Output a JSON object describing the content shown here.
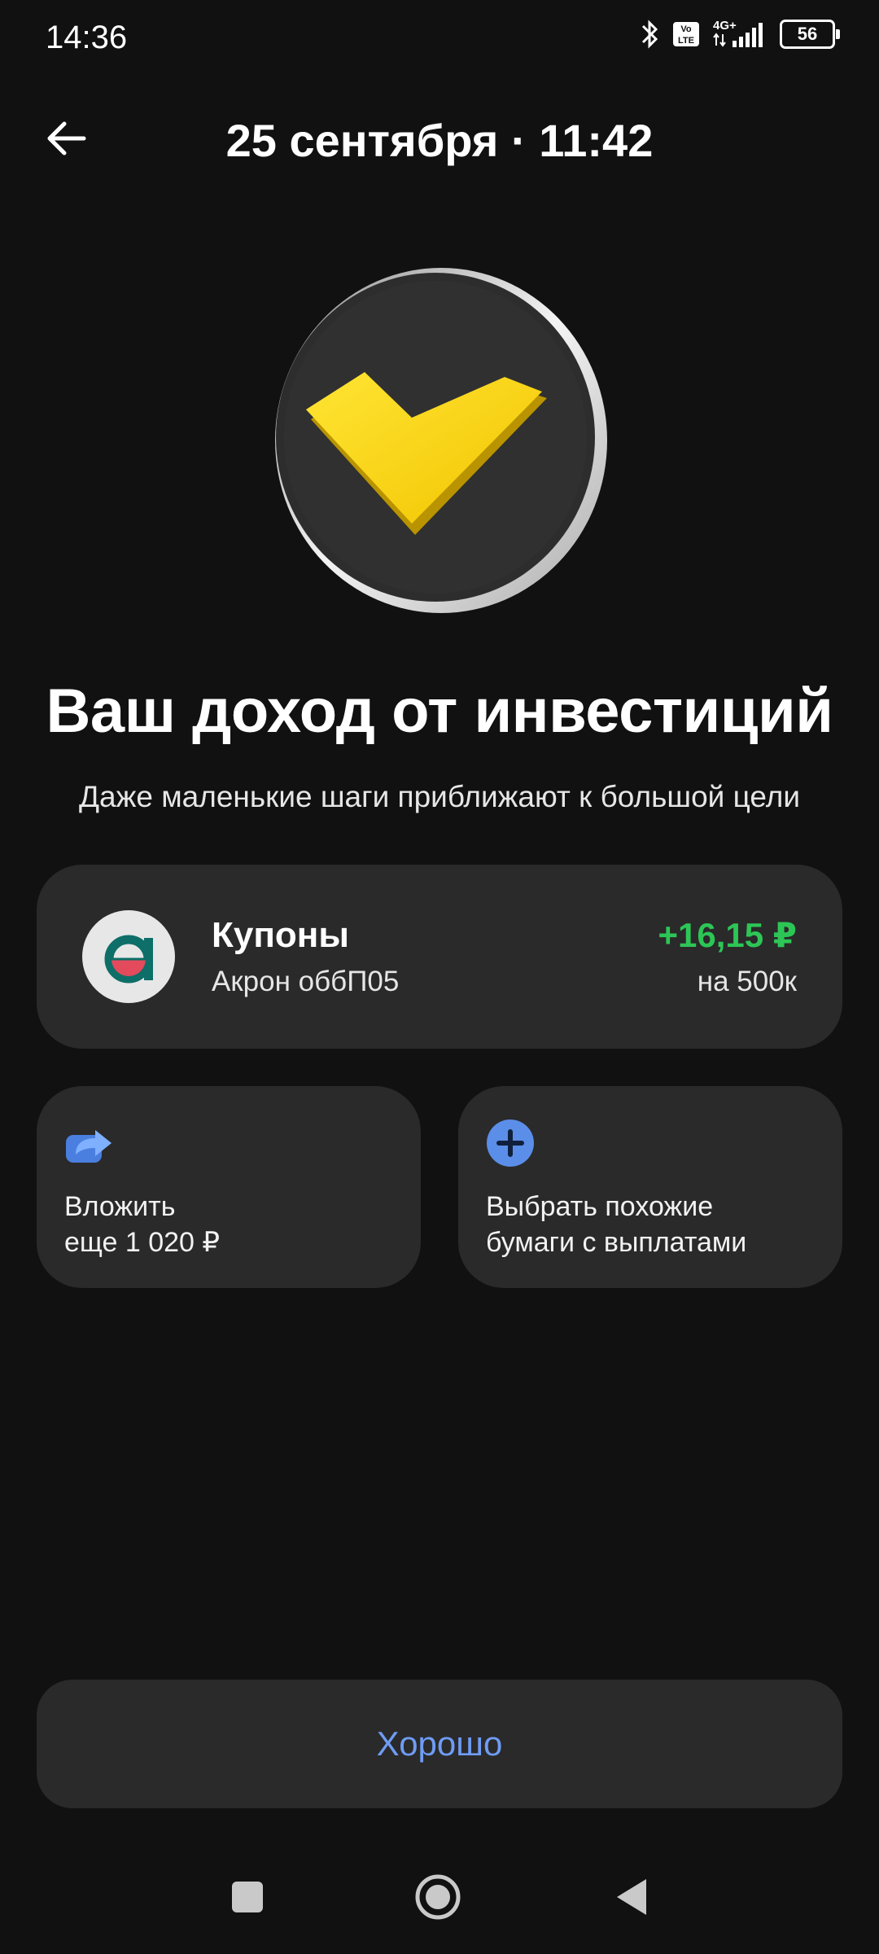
{
  "status_bar": {
    "time": "14:36",
    "volte_label": "Vo\nLTE",
    "network_label": "4G+",
    "battery_level": "56"
  },
  "header": {
    "title": "25 сентября · 11:42"
  },
  "hero": {
    "icon": "yellow-checkmark-coin",
    "colors": {
      "coin": "#2b2b2b",
      "rim": "#d8d8d8",
      "check": "#ffdd2d"
    }
  },
  "main": {
    "title": "Ваш доход от инвестиций",
    "subtitle": "Даже маленькие шаги приближают к большой цели"
  },
  "coupon": {
    "title": "Купоны",
    "security": "Акрон обб­П05",
    "amount": "+16,15 ₽",
    "note": "на 500к",
    "logo_icon": "akron-logo",
    "amount_color": "#2dc656"
  },
  "actions": [
    {
      "icon": "share-arrow-icon",
      "line1": "Вложить",
      "line2": "еще 1 020 ₽"
    },
    {
      "icon": "plus-circle-icon",
      "line1": "Выбрать похожие",
      "line2": "бумаги с выплатами"
    }
  ],
  "ok_button": {
    "label": "Хорошо",
    "color": "#6f9cf4"
  },
  "nav": {
    "items": [
      "recent-apps",
      "home",
      "back"
    ]
  }
}
